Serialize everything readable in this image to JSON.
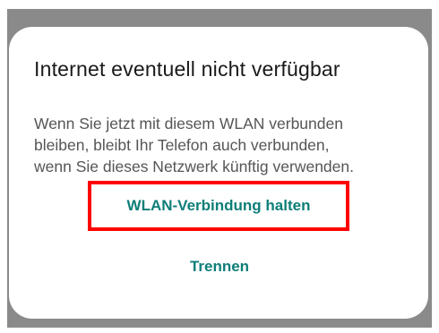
{
  "dialog": {
    "title": "Internet eventuell nicht verfügbar",
    "message_lines": [
      "Wenn Sie jetzt mit diesem WLAN verbunden",
      "bleiben, bleibt Ihr Telefon auch verbunden,",
      "wenn Sie dieses Netzwerk künftig verwenden."
    ],
    "keep_button_label": "WLAN-Verbindung halten",
    "disconnect_button_label": "Trennen"
  },
  "colors": {
    "accent": "#0e7e78",
    "highlight_box": "#ff0000",
    "scrim": "#8a8a8a"
  }
}
